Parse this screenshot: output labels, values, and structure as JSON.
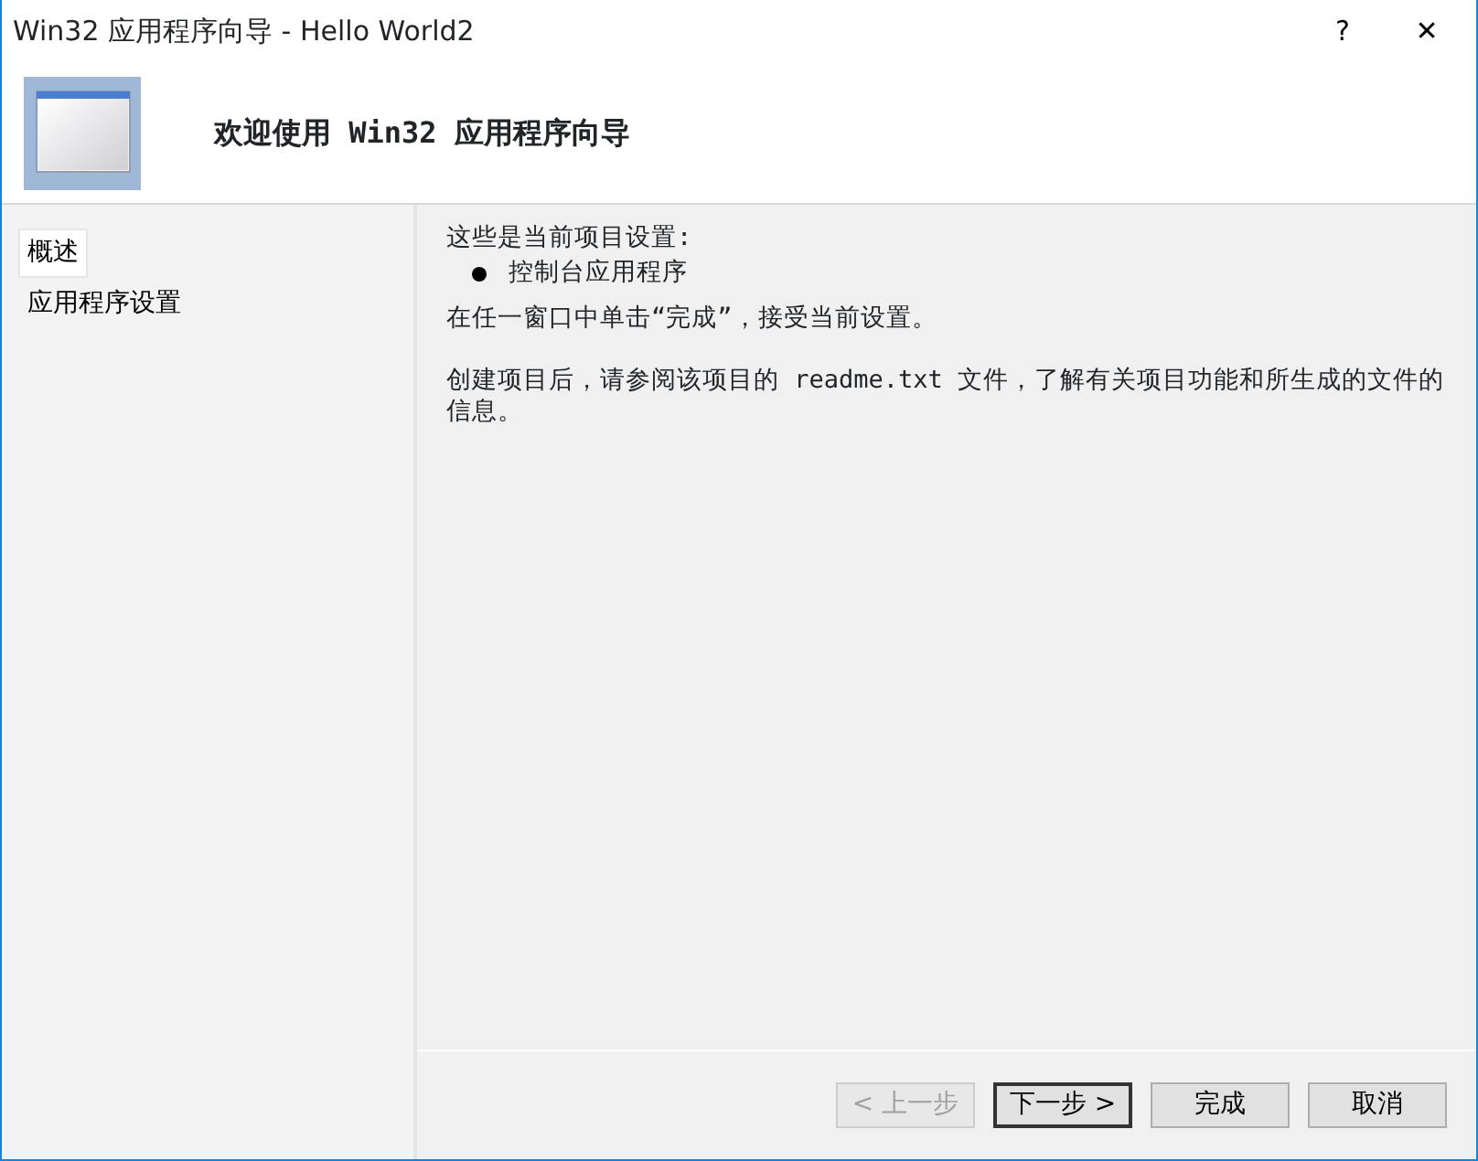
{
  "window": {
    "title": "Win32 应用程序向导 - Hello World2",
    "help": "?",
    "close": "✕"
  },
  "header": {
    "title": "欢迎使用 Win32 应用程序向导"
  },
  "sidebar": {
    "items": [
      {
        "label": "概述",
        "selected": true
      },
      {
        "label": "应用程序设置",
        "selected": false
      }
    ]
  },
  "content": {
    "intro": "这些是当前项目设置:",
    "bullets": [
      "控制台应用程序"
    ],
    "paragraphs": [
      "在任一窗口中单击“完成”，接受当前设置。",
      "创建项目后，请参阅该项目的 readme.txt 文件，了解有关项目功能和所生成的文件的信息。"
    ]
  },
  "buttons": [
    {
      "label": "< 上一步",
      "disabled": true,
      "default": false
    },
    {
      "label": "下一步 >",
      "disabled": false,
      "default": true
    },
    {
      "label": "完成",
      "disabled": false,
      "default": false
    },
    {
      "label": "取消",
      "disabled": false,
      "default": false
    }
  ]
}
